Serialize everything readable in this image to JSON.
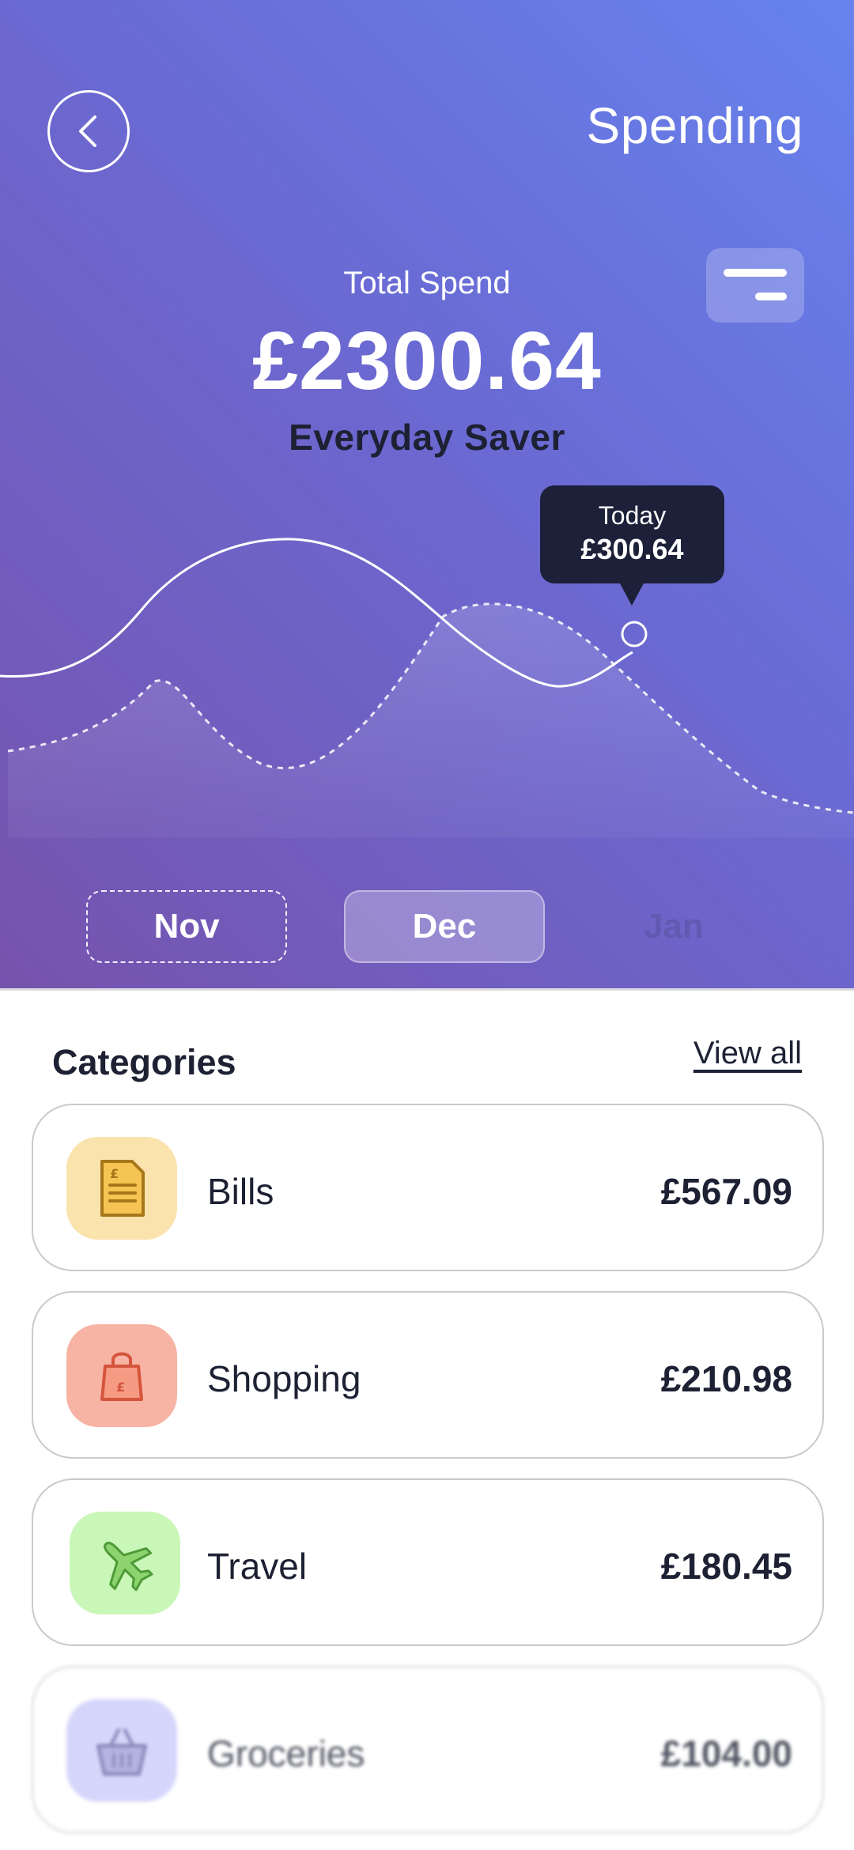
{
  "header": {
    "title": "Spending",
    "back_icon": "chevron-left-icon",
    "filter_icon": "filter-lines-icon"
  },
  "summary": {
    "label": "Total Spend",
    "amount": "£2300.64",
    "account": "Everyday Saver"
  },
  "tooltip": {
    "label": "Today",
    "value": "£300.64"
  },
  "months": [
    "Nov",
    "Dec",
    "Jan"
  ],
  "selected_month": "Dec",
  "categories": {
    "title": "Categories",
    "view_all": "View all",
    "items": [
      {
        "name": "Bills",
        "amount": "£567.09",
        "icon": "bill-icon",
        "color": "#fbe3ae"
      },
      {
        "name": "Shopping",
        "amount": "£210.98",
        "icon": "shopping-bag-icon",
        "color": "#f7b3a3"
      },
      {
        "name": "Travel",
        "amount": "£180.45",
        "icon": "airplane-icon",
        "color": "#c9f7b7"
      },
      {
        "name": "Groceries",
        "amount": "£104.00",
        "icon": "basket-icon",
        "color": "#c9c9fb"
      }
    ]
  },
  "colors": {
    "gradient_start": "#6683ee",
    "gradient_end": "#7653ad",
    "dark": "#1c2038"
  }
}
